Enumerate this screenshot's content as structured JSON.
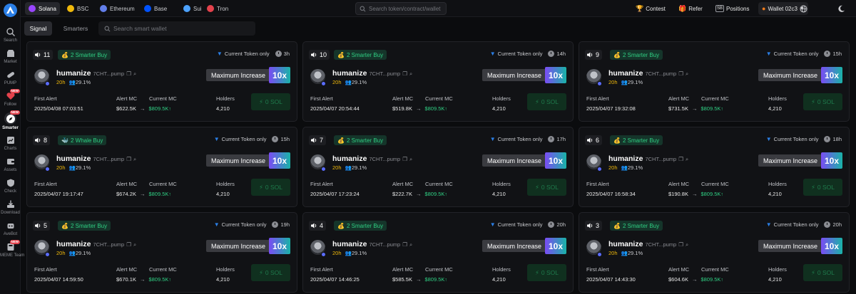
{
  "nav": {
    "items": [
      {
        "label": "Search",
        "icon": "search-icon",
        "new": false,
        "active": false
      },
      {
        "label": "Market",
        "icon": "market-icon",
        "new": false,
        "active": false
      },
      {
        "label": "PUMP",
        "icon": "pill-icon",
        "new": false,
        "active": false
      },
      {
        "label": "Follow",
        "icon": "heart-icon",
        "new": true,
        "active": false
      },
      {
        "label": "Smarter",
        "icon": "compass-icon",
        "new": true,
        "active": true
      },
      {
        "label": "Charts",
        "icon": "charts-icon",
        "new": false,
        "active": false
      },
      {
        "label": "Assets",
        "icon": "assets-icon",
        "new": false,
        "active": false
      },
      {
        "label": "Check",
        "icon": "check-shield-icon",
        "new": false,
        "active": false
      },
      {
        "label": "Download",
        "icon": "download-icon",
        "new": false,
        "active": false
      },
      {
        "label": "AveBot",
        "icon": "bot-icon",
        "new": false,
        "active": false
      },
      {
        "label": "MEME Team",
        "icon": "meme-team-icon",
        "new": true,
        "active": false
      }
    ],
    "new_badge": "NEW"
  },
  "chains": [
    {
      "label": "Solana",
      "color": "#9945ff",
      "active": true
    },
    {
      "label": "BSC",
      "color": "#f0b90b",
      "active": false
    },
    {
      "label": "Ethereum",
      "color": "#627eea",
      "active": false
    },
    {
      "label": "Base",
      "color": "#0052ff",
      "active": false
    },
    {
      "label": "Sui",
      "color": "#4da2ff",
      "active": false
    },
    {
      "label": "Tron",
      "color": "#e4424c",
      "active": false
    }
  ],
  "topbar": {
    "search_placeholder": "Search token/contract/wallet",
    "contest": "Contest",
    "refer": "Refer",
    "positions_icon": "SB",
    "positions": "Positions",
    "wallet": "Wallet 02c3"
  },
  "subbar": {
    "tab_signal": "Signal",
    "tab_smarters": "Smarters",
    "search_placeholder": "Search smart wallet"
  },
  "card_labels": {
    "current_only": "Current Token only",
    "max_increase": "Maximum Increase",
    "first_alert": "First Alert",
    "alert_mc": "Alert MC",
    "current_mc": "Current MC",
    "holders": "Holders",
    "arrow": "→",
    "up": "↑"
  },
  "cards": [
    {
      "count": "11",
      "badge": "2 Smarter Buy",
      "badge_icon": "money-bag-icon",
      "time": "3h",
      "name": "humanize",
      "addr": "7CHT...pump",
      "age": "20h",
      "pct": "29.1%",
      "multiplier": "10x",
      "first_alert": "2025/04/08 07:03:51",
      "alert_mc": "$622.5K",
      "current_mc": "$809.5K",
      "holders": "4,210",
      "sol": "0 SOL"
    },
    {
      "count": "10",
      "badge": "2 Smarter Buy",
      "badge_icon": "money-bag-icon",
      "time": "14h",
      "name": "humanize",
      "addr": "7CHT...pump",
      "age": "20h",
      "pct": "29.1%",
      "multiplier": "10x",
      "first_alert": "2025/04/07 20:54:44",
      "alert_mc": "$519.8K",
      "current_mc": "$809.5K",
      "holders": "4,210",
      "sol": "0 SOL"
    },
    {
      "count": "9",
      "badge": "2 Smarter Buy",
      "badge_icon": "money-bag-icon",
      "time": "15h",
      "name": "humanize",
      "addr": "7CHT...pump",
      "age": "20h",
      "pct": "29.1%",
      "multiplier": "10x",
      "first_alert": "2025/04/07 19:32:08",
      "alert_mc": "$731.5K",
      "current_mc": "$809.5K",
      "holders": "4,210",
      "sol": "0 SOL"
    },
    {
      "count": "8",
      "badge": "2 Whale Buy",
      "badge_icon": "whale-icon",
      "time": "15h",
      "name": "humanize",
      "addr": "7CHT...pump",
      "age": "20h",
      "pct": "29.1%",
      "multiplier": "10x",
      "first_alert": "2025/04/07 19:17:47",
      "alert_mc": "$674.2K",
      "current_mc": "$809.5K",
      "holders": "4,210",
      "sol": "0 SOL"
    },
    {
      "count": "7",
      "badge": "2 Smarter Buy",
      "badge_icon": "money-bag-icon",
      "time": "17h",
      "name": "humanize",
      "addr": "7CHT...pump",
      "age": "20h",
      "pct": "29.1%",
      "multiplier": "10x",
      "first_alert": "2025/04/07 17:23:24",
      "alert_mc": "$222.7K",
      "current_mc": "$809.5K",
      "holders": "4,210",
      "sol": "0 SOL"
    },
    {
      "count": "6",
      "badge": "2 Smarter Buy",
      "badge_icon": "money-bag-icon",
      "time": "18h",
      "name": "humanize",
      "addr": "7CHT...pump",
      "age": "20h",
      "pct": "29.1%",
      "multiplier": "10x",
      "first_alert": "2025/04/07 16:58:34",
      "alert_mc": "$190.8K",
      "current_mc": "$809.5K",
      "holders": "4,210",
      "sol": "0 SOL"
    },
    {
      "count": "5",
      "badge": "2 Smarter Buy",
      "badge_icon": "money-bag-icon",
      "time": "19h",
      "name": "humanize",
      "addr": "7CHT...pump",
      "age": "20h",
      "pct": "29.1%",
      "multiplier": "10x",
      "first_alert": "2025/04/07 14:59:50",
      "alert_mc": "$670.1K",
      "current_mc": "$809.5K",
      "holders": "4,210",
      "sol": "0 SOL"
    },
    {
      "count": "4",
      "badge": "2 Smarter Buy",
      "badge_icon": "money-bag-icon",
      "time": "20h",
      "name": "humanize",
      "addr": "7CHT...pump",
      "age": "20h",
      "pct": "29.1%",
      "multiplier": "10x",
      "first_alert": "2025/04/07 14:46:25",
      "alert_mc": "$585.5K",
      "current_mc": "$809.5K",
      "holders": "4,210",
      "sol": "0 SOL"
    },
    {
      "count": "3",
      "badge": "2 Smarter Buy",
      "badge_icon": "money-bag-icon",
      "time": "20h",
      "name": "humanize",
      "addr": "7CHT...pump",
      "age": "20h",
      "pct": "29.1%",
      "multiplier": "10x",
      "first_alert": "2025/04/07 14:43:30",
      "alert_mc": "$604.6K",
      "current_mc": "$809.5K",
      "holders": "4,210",
      "sol": "0 SOL"
    }
  ]
}
